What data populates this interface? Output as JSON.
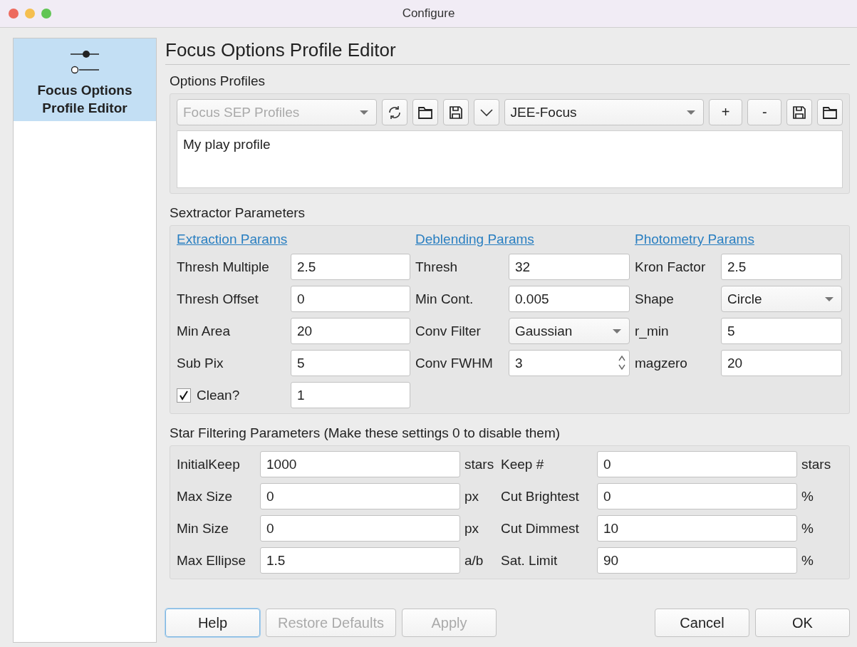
{
  "window": {
    "title": "Configure"
  },
  "sidebar": {
    "items": [
      {
        "label": "Focus Options Profile Editor",
        "selected": true
      }
    ]
  },
  "page_title": "Focus Options Profile Editor",
  "options_profiles": {
    "title": "Options Profiles",
    "source_combo": {
      "value": "Focus SEP Profiles",
      "disabled": true
    },
    "profile_combo": {
      "value": "JEE-Focus",
      "disabled": false
    },
    "add_button": "+",
    "remove_button": "-",
    "description": "My play profile"
  },
  "sextractor": {
    "title": "Sextractor Parameters",
    "columns": [
      {
        "heading": "Extraction Params",
        "rows": [
          {
            "kind": "text",
            "label": "Thresh Multiple",
            "value": "2.5"
          },
          {
            "kind": "text",
            "label": "Thresh Offset",
            "value": "0"
          },
          {
            "kind": "text",
            "label": "Min Area",
            "value": "20"
          },
          {
            "kind": "text",
            "label": "Sub Pix",
            "value": "5"
          },
          {
            "kind": "checkbox",
            "label": "Clean?",
            "checked": true,
            "value": "1"
          }
        ]
      },
      {
        "heading": "Deblending Params",
        "rows": [
          {
            "kind": "text",
            "label": "Thresh",
            "value": "32"
          },
          {
            "kind": "text",
            "label": "Min Cont.",
            "value": "0.005"
          },
          {
            "kind": "combo",
            "label": "Conv Filter",
            "value": "Gaussian"
          },
          {
            "kind": "spin",
            "label": "Conv FWHM",
            "value": "3"
          }
        ]
      },
      {
        "heading": "Photometry Params",
        "rows": [
          {
            "kind": "text",
            "label": "Kron Factor",
            "value": "2.5"
          },
          {
            "kind": "combo",
            "label": "Shape",
            "value": "Circle"
          },
          {
            "kind": "text",
            "label": "r_min",
            "value": "5"
          },
          {
            "kind": "text",
            "label": "magzero",
            "value": "20"
          }
        ]
      }
    ]
  },
  "star_filtering": {
    "title": "Star Filtering Parameters (Make these settings 0 to disable them)",
    "rows": [
      {
        "left": {
          "label": "InitialKeep",
          "value": "1000",
          "unit": "stars"
        },
        "right": {
          "label": "Keep #",
          "value": "0",
          "unit": "stars"
        }
      },
      {
        "left": {
          "label": "Max Size",
          "value": "0",
          "unit": "px"
        },
        "right": {
          "label": "Cut Brightest",
          "value": "0",
          "unit": "%"
        }
      },
      {
        "left": {
          "label": "Min Size",
          "value": "0",
          "unit": "px"
        },
        "right": {
          "label": "Cut Dimmest",
          "value": "10",
          "unit": "%"
        }
      },
      {
        "left": {
          "label": "Max Ellipse",
          "value": "1.5",
          "unit": "a/b"
        },
        "right": {
          "label": "Sat. Limit",
          "value": "90",
          "unit": "%"
        }
      }
    ]
  },
  "buttons": [
    {
      "label": "Help",
      "disabled": false,
      "focused": true
    },
    {
      "label": "Restore Defaults",
      "disabled": true,
      "focused": false
    },
    {
      "label": "Apply",
      "disabled": true,
      "focused": false
    },
    {
      "label": "Cancel",
      "disabled": false,
      "focused": false
    },
    {
      "label": "OK",
      "disabled": false,
      "focused": false
    }
  ]
}
